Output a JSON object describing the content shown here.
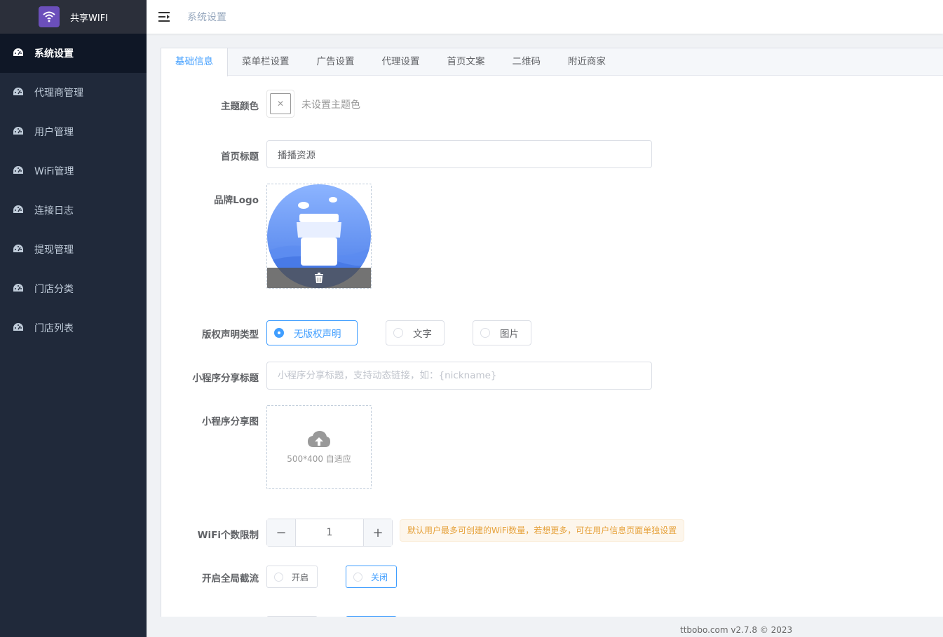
{
  "app": {
    "name": "共享WIFI"
  },
  "sidebar": {
    "items": [
      {
        "label": "系统设置",
        "active": true
      },
      {
        "label": "代理商管理"
      },
      {
        "label": "用户管理"
      },
      {
        "label": "WiFi管理"
      },
      {
        "label": "连接日志"
      },
      {
        "label": "提现管理"
      },
      {
        "label": "门店分类"
      },
      {
        "label": "门店列表"
      }
    ]
  },
  "header": {
    "breadcrumb": "系统设置"
  },
  "tabs": [
    {
      "label": "基础信息",
      "active": true
    },
    {
      "label": "菜单栏设置"
    },
    {
      "label": "广告设置"
    },
    {
      "label": "代理设置"
    },
    {
      "label": "首页文案"
    },
    {
      "label": "二维码"
    },
    {
      "label": "附近商家"
    }
  ],
  "form": {
    "theme_color": {
      "label": "主题颜色",
      "hint": "未设置主题色"
    },
    "home_title": {
      "label": "首页标题",
      "value": "播播资源"
    },
    "brand_logo": {
      "label": "品牌Logo"
    },
    "copyright_type": {
      "label": "版权声明类型",
      "options": [
        "无版权声明",
        "文字",
        "图片"
      ],
      "selected": "无版权声明"
    },
    "share_title": {
      "label": "小程序分享标题",
      "placeholder": "小程序分享标题，支持动态链接，如：{nickname}"
    },
    "share_image": {
      "label": "小程序分享图",
      "hint": "500*400 自适应"
    },
    "wifi_limit": {
      "label": "WiFi个数限制",
      "value": "1",
      "minus": "−",
      "plus": "+",
      "tip": "默认用户最多可创建的WiFi数量，若想更多，可在用户信息页面单独设置"
    },
    "global_intercept": {
      "label": "开启全局截流",
      "options": [
        "开启",
        "关闭"
      ],
      "selected": "关闭"
    }
  },
  "footer": {
    "text": "ttbobo.com v2.7.8 © 2023"
  },
  "colors": {
    "accent": "#409eff",
    "sidebar_bg": "#20293a",
    "sidebar_active": "#0f1726",
    "logo_bg": "#6b4fbb"
  }
}
